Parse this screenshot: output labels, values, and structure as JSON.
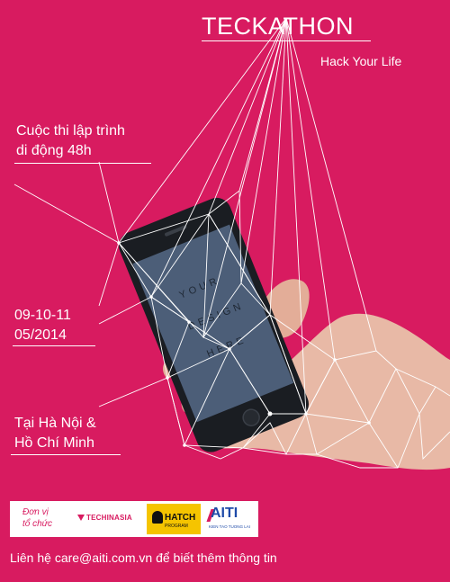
{
  "event": {
    "title": "TECKATHON",
    "tagline": "Hack Your Life"
  },
  "info": {
    "description_line1": "Cuộc thi lập trình",
    "description_line2": "di động 48h",
    "dates_line1": "09-10-11",
    "dates_line2": "05/2014",
    "location_line1": "Tại Hà Nội &",
    "location_line2": "Hồ Chí Minh"
  },
  "phone_screen": {
    "line1": "YOUR",
    "line2": "DESIGN",
    "line3": "HERE"
  },
  "sponsors": {
    "label_line1": "Đơn vị",
    "label_line2": "tổ chức",
    "logos": {
      "techinasia": "TECHINASIA",
      "hatch": "HATCH",
      "hatch_sub": "PROGRAM",
      "aiti": "AITI",
      "aiti_sub": "KIEN TAO TUONG LAI"
    }
  },
  "contact": "Liên hệ care@aiti.com.vn để biết thêm thông tin",
  "colors": {
    "background": "#d81b60",
    "text": "#ffffff"
  }
}
